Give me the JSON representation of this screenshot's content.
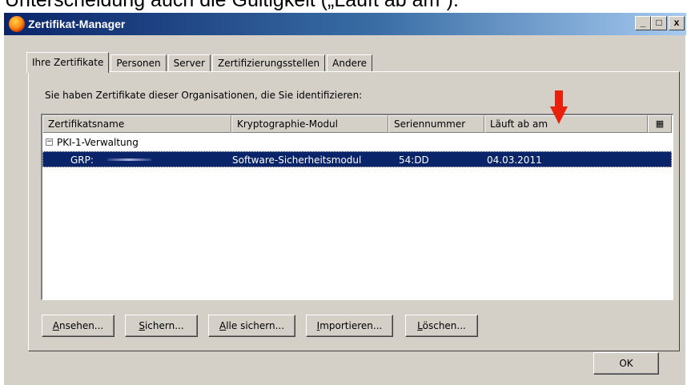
{
  "caption": "Unterscheidung auch die Gültigkeit („Läuft ab am“).",
  "window": {
    "title": "Zertifikat-Manager",
    "controls": {
      "minimize": "_",
      "maximize": "□",
      "close": "x"
    }
  },
  "tabs": [
    {
      "label": "Ihre Zertifikate",
      "active": true
    },
    {
      "label": "Personen",
      "active": false
    },
    {
      "label": "Server",
      "active": false
    },
    {
      "label": "Zertifizierungsstellen",
      "active": false
    },
    {
      "label": "Andere",
      "active": false
    }
  ],
  "intro_text": "Sie haben Zertifikate dieser Organisationen, die Sie identifizieren:",
  "table": {
    "columns": [
      "Zertifikatsname",
      "Kryptographie-Modul",
      "Seriennummer",
      "Läuft ab am"
    ],
    "column_picker_icon": "column-picker-icon",
    "group": {
      "expander": "−",
      "label": "PKI-1-Verwaltung"
    },
    "rows": [
      {
        "name": "GRP:",
        "module": "Software-Sicherheitsmodul",
        "serial": "54:DD",
        "expires": "04.03.2011",
        "selected": true
      }
    ]
  },
  "buttons": {
    "view": {
      "accel": "A",
      "rest": "nsehen..."
    },
    "backup": {
      "accel": "S",
      "rest": "ichern..."
    },
    "backup_all": {
      "accel": "A",
      "rest": "lle sichern..."
    },
    "import": {
      "accel": "I",
      "rest": "mportieren..."
    },
    "delete": {
      "accel": "L",
      "rest": "öschen..."
    },
    "ok": "OK"
  },
  "annotation": {
    "icon": "red-down-arrow-icon",
    "color": "#e8200c"
  },
  "colors": {
    "title_start": "#0a246a",
    "title_end": "#a6caf0",
    "selection": "#0a246a",
    "face": "#d4d0c8"
  }
}
